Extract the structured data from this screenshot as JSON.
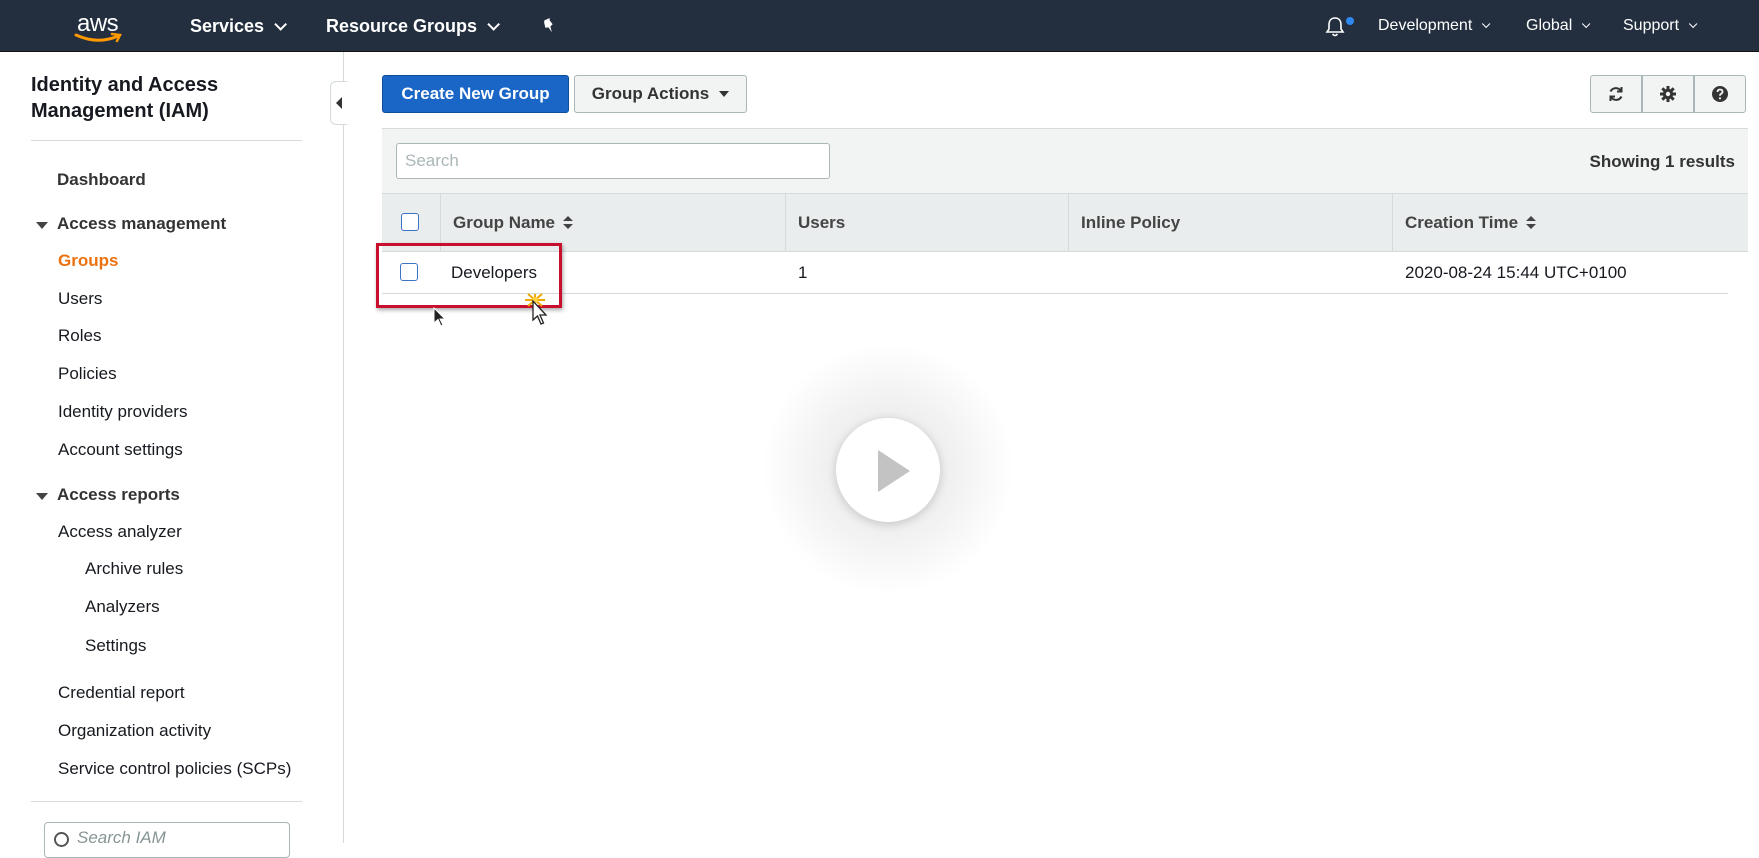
{
  "topnav": {
    "logo_text": "aws",
    "services": "Services",
    "resource_groups": "Resource Groups",
    "account": "Development",
    "region": "Global",
    "support": "Support",
    "notification_dot_color": "#2f88f0"
  },
  "sidebar": {
    "title": "Identity and Access Management (IAM)",
    "dashboard": "Dashboard",
    "access_management": {
      "header": "Access management",
      "items": [
        "Groups",
        "Users",
        "Roles",
        "Policies",
        "Identity providers",
        "Account settings"
      ],
      "active": "Groups"
    },
    "access_reports": {
      "header": "Access reports",
      "analyzer": "Access analyzer",
      "analyzer_items": [
        "Archive rules",
        "Analyzers",
        "Settings"
      ],
      "items": [
        "Credential report",
        "Organization activity",
        "Service control policies (SCPs)"
      ]
    },
    "search_placeholder": "Search IAM"
  },
  "main": {
    "create_button": "Create New Group",
    "actions_button": "Group Actions",
    "search_placeholder": "Search",
    "results_text": "Showing 1 results",
    "columns": [
      "Group Name",
      "Users",
      "Inline Policy",
      "Creation Time"
    ],
    "rows": [
      {
        "group_name": "Developers",
        "users": "1",
        "inline_policy": "",
        "creation_time": "2020-08-24 15:44 UTC+0100"
      }
    ]
  },
  "colors": {
    "nav_bg": "#232f3e",
    "primary_button": "#1a66c7",
    "active_link": "#ec7211",
    "highlight_box": "#c8102e"
  }
}
